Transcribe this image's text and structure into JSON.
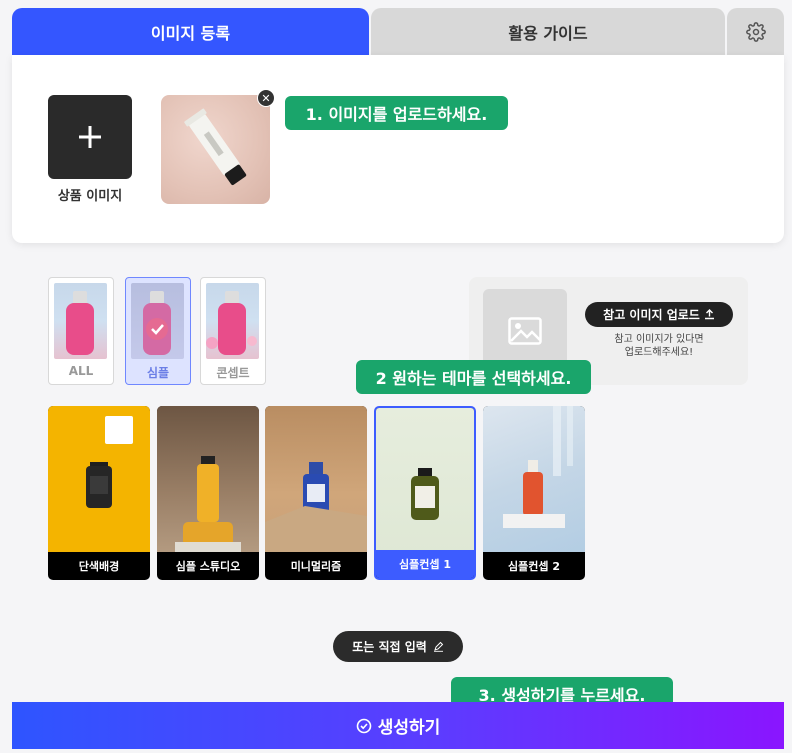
{
  "tabs": {
    "register": "이미지 등록",
    "guide": "활용 가이드",
    "settings_icon": "gear-icon"
  },
  "upload": {
    "add_label": "상품 이미지",
    "remove_symbol": "✕"
  },
  "callouts": {
    "step1": "1. 이미지를 업로드하세요.",
    "step2": "2 원하는 테마를 선택하세요.",
    "step3": "3. 생성하기를 누르세요."
  },
  "theme_tabs": [
    {
      "label": "ALL",
      "active": false
    },
    {
      "label": "심플",
      "active": true
    },
    {
      "label": "콘셉트",
      "active": false
    }
  ],
  "reference": {
    "button_label": "참고 이미지 업로드",
    "hint_line1": "참고 이미지가 있다면",
    "hint_line2": "업로드해주세요!"
  },
  "themes": [
    {
      "name": "단색배경",
      "selected": false
    },
    {
      "name": "심플 스튜디오",
      "selected": false
    },
    {
      "name": "미니멀리즘",
      "selected": false
    },
    {
      "name": "심플컨셉 1",
      "selected": true
    },
    {
      "name": "심플컨셉 2",
      "selected": false
    }
  ],
  "actions": {
    "direct_input": "또는 직접 입력",
    "generate": "생성하기"
  },
  "colors": {
    "primary": "#3456ff",
    "callout_green": "#1aa56b",
    "selected_border": "#3d5cff"
  }
}
